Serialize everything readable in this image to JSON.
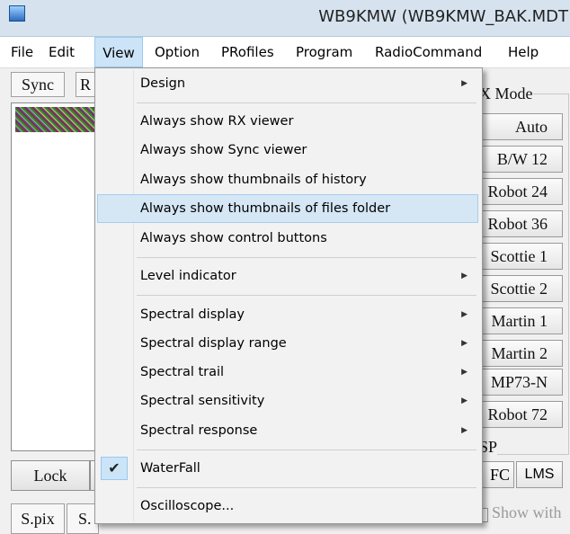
{
  "window": {
    "title": "WB9KMW (WB9KMW_BAK.MDT"
  },
  "menubar": {
    "items": [
      {
        "label": "File"
      },
      {
        "label": "Edit"
      },
      {
        "label": "View"
      },
      {
        "label": "Option"
      },
      {
        "label": "PRofiles"
      },
      {
        "label": "Program"
      },
      {
        "label": "RadioCommand"
      },
      {
        "label": "Help"
      }
    ],
    "active": "View"
  },
  "background": {
    "tab_sync": "Sync",
    "tab_r": "R",
    "lock_button": "Lock",
    "lock_neighbor": "S",
    "bottom_tab_spix": "S.pix",
    "bottom_tab_s": "S.",
    "rx_mode_caption": "X Mode",
    "dsp_caption": "SP",
    "afc_button": "FC",
    "lms_button": "LMS",
    "show_with": "Show with",
    "modes": [
      "Auto",
      "B/W 12",
      "Robot 24",
      "Robot 36",
      "Scottie 1",
      "Scottie 2",
      "Martin 1",
      "Martin 2",
      "MP73-N",
      "Robot 72"
    ]
  },
  "view_menu": {
    "items": [
      {
        "label": "Design",
        "submenu": true
      },
      {
        "label": "Always show RX viewer",
        "submenu": false
      },
      {
        "label": "Always show Sync viewer",
        "submenu": false
      },
      {
        "label": "Always show thumbnails of history",
        "submenu": false
      },
      {
        "label": "Always show thumbnails of files folder",
        "submenu": false,
        "highlighted": true
      },
      {
        "label": "Always show control buttons",
        "submenu": false
      },
      {
        "label": "Level indicator",
        "submenu": true
      },
      {
        "label": "Spectral display",
        "submenu": true
      },
      {
        "label": "Spectral display range",
        "submenu": true
      },
      {
        "label": "Spectral trail",
        "submenu": true
      },
      {
        "label": "Spectral sensitivity",
        "submenu": true
      },
      {
        "label": "Spectral response",
        "submenu": true
      },
      {
        "label": "WaterFall",
        "submenu": false,
        "checked": true
      },
      {
        "label": "Oscilloscope...",
        "submenu": false
      }
    ],
    "check_glyph": "✔",
    "arrow_glyph": "▶"
  },
  "colors": {
    "menu_highlight": "#d5e6f5",
    "menu_active_bg": "#cce4f7"
  }
}
